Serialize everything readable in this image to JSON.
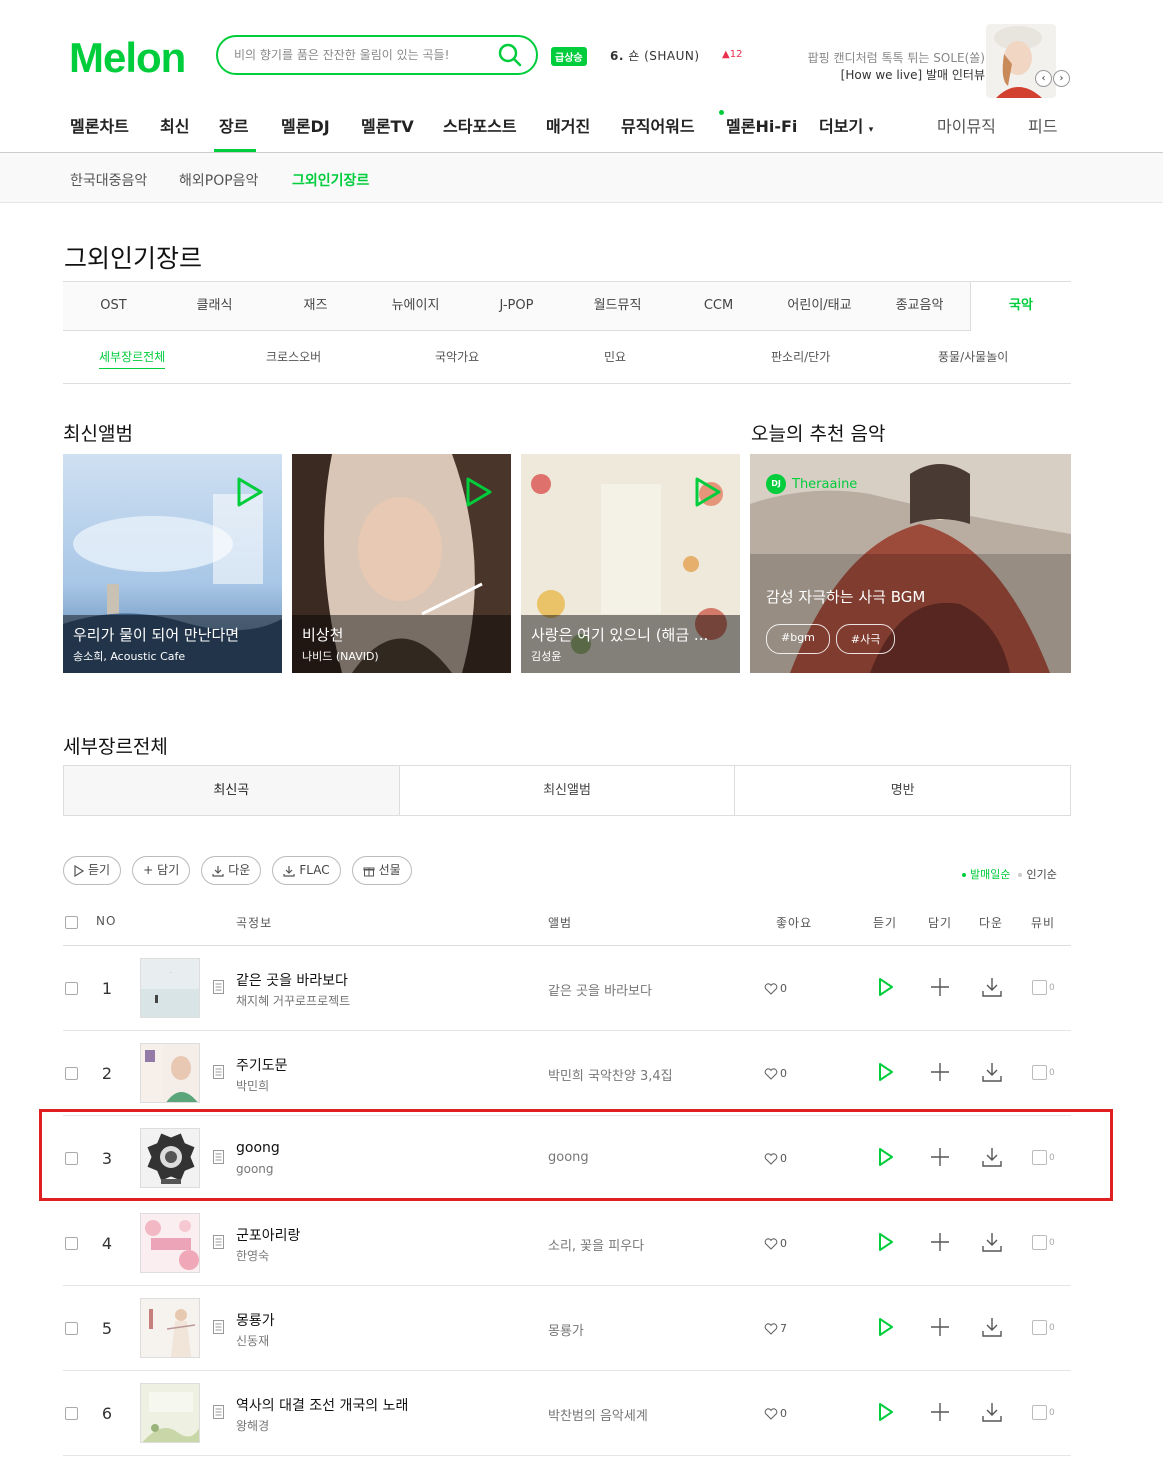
{
  "header": {
    "logo": "Melon",
    "search_placeholder": "비의 향기를 품은 잔잔한 울림이 있는 곡들!",
    "trend_badge": "급상승",
    "trend_rank": "6.",
    "trend_name": "숀 (SHAUN)",
    "trend_change": "12",
    "promo_line1": "팝핑 캔디처럼 톡톡 튀는 SOLE(쏠)",
    "promo_line2": "[How we live] 발매 인터뷰"
  },
  "gnb": [
    {
      "label": "멜론차트"
    },
    {
      "label": "최신"
    },
    {
      "label": "장르"
    },
    {
      "label": "멜론DJ"
    },
    {
      "label": "멜론TV"
    },
    {
      "label": "스타포스트"
    },
    {
      "label": "매거진"
    },
    {
      "label": "뮤직어워드"
    },
    {
      "label": "멜론Hi-Fi"
    },
    {
      "label": "더보기"
    },
    {
      "label": "마이뮤직"
    },
    {
      "label": "피드"
    }
  ],
  "subnav": [
    "한국대중음악",
    "해외POP음악",
    "그외인기장르"
  ],
  "page_title": "그외인기장르",
  "genre_tabs": [
    "OST",
    "클래식",
    "재즈",
    "뉴에이지",
    "J-POP",
    "월드뮤직",
    "CCM",
    "어린이/태교",
    "종교음악",
    "국악"
  ],
  "sub_genres": [
    "세부장르전체",
    "크로스오버",
    "국악가요",
    "민요",
    "판소리/단가",
    "풍물/사물놀이"
  ],
  "latest_albums": {
    "title": "최신앨범",
    "items": [
      {
        "title": "우리가 물이 되어 만난다면",
        "artist": "송소희, Acoustic Cafe"
      },
      {
        "title": "비상천",
        "artist": "나비드 (NAVID)"
      },
      {
        "title": "사랑은 여기 있으니 (해금 ...",
        "artist": "김성윤"
      }
    ]
  },
  "recommend": {
    "title": "오늘의 추천 음악",
    "dj_badge": "DJ",
    "dj_name": "Theraaine",
    "playlist_title": "감성 자극하는 사극 BGM",
    "tags": [
      "#bgm",
      "#사극"
    ]
  },
  "list_section": {
    "title": "세부장르전체",
    "tabs": [
      "최신곡",
      "최신앨범",
      "명반"
    ],
    "buttons": [
      "듣기",
      "담기",
      "다운",
      "FLAC",
      "선물"
    ],
    "sort_on": "발매일순",
    "sort_off": "인기순",
    "headers": {
      "no": "NO",
      "info": "곡정보",
      "album": "앨범",
      "like": "좋아요",
      "listen": "듣기",
      "add": "담기",
      "down": "다운",
      "mv": "뮤비"
    }
  },
  "songs": [
    {
      "no": "1",
      "title": "같은 곳을 바라보다",
      "artist": "채지혜 거꾸로프로젝트",
      "album": "같은 곳을 바라보다",
      "likes": "0",
      "mv": "0"
    },
    {
      "no": "2",
      "title": "주기도문",
      "artist": "박민희",
      "album": "박민희 국악찬양 3,4집",
      "likes": "0",
      "mv": "0"
    },
    {
      "no": "3",
      "title": "goong",
      "artist": "goong",
      "album": "goong",
      "likes": "0",
      "mv": "0"
    },
    {
      "no": "4",
      "title": "군포아리랑",
      "artist": "한영숙",
      "album": "소리, 꽃을 피우다",
      "likes": "0",
      "mv": "0"
    },
    {
      "no": "5",
      "title": "몽룡가",
      "artist": "신동재",
      "album": "몽룡가",
      "likes": "7",
      "mv": "0"
    },
    {
      "no": "6",
      "title": "역사의 대결 조선 개국의 노래",
      "artist": "왕해경",
      "album": "박찬범의 음악세계",
      "likes": "0",
      "mv": "0"
    }
  ],
  "colors": {
    "accent": "#00cd3c",
    "highlight": "#e02020"
  }
}
